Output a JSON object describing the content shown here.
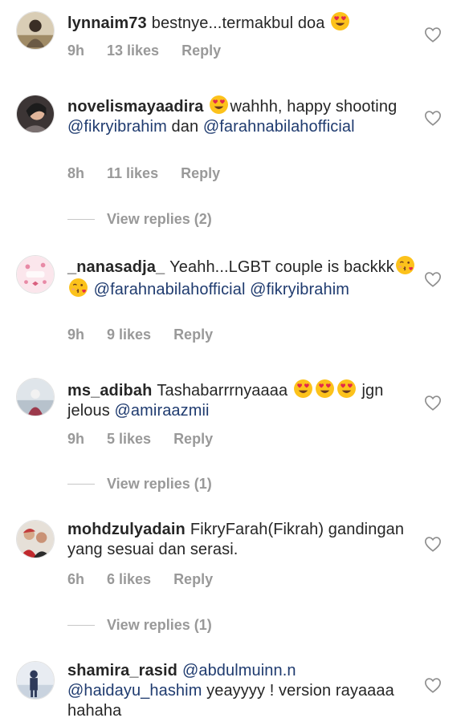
{
  "comments": [
    {
      "username": "lynnaim73",
      "parts": [
        {
          "t": "text",
          "v": "bestnye...termakbul doa "
        },
        {
          "t": "emoji",
          "v": "heart-eyes"
        }
      ],
      "time": "9h",
      "likes": "13 likes",
      "reply": "Reply"
    },
    {
      "username": "novelismayaadira",
      "parts": [
        {
          "t": "emoji",
          "v": "heart-eyes"
        },
        {
          "t": "text",
          "v": "wahhh, happy shooting "
        },
        {
          "t": "mention",
          "v": "@fikryibrahim"
        },
        {
          "t": "text",
          "v": "  dan "
        },
        {
          "t": "mention",
          "v": "@farahnabilahofficial"
        }
      ],
      "time": "8h",
      "likes": "11 likes",
      "reply": "Reply",
      "view_replies": "View replies (2)"
    },
    {
      "username": "_nanasadja_",
      "parts": [
        {
          "t": "text",
          "v": "Yeahh...LGBT couple is backkk"
        },
        {
          "t": "emoji",
          "v": "kiss"
        },
        {
          "t": "emoji",
          "v": "kiss"
        },
        {
          "t": "text",
          "v": " "
        },
        {
          "t": "mention",
          "v": "@farahnabilahofficial"
        },
        {
          "t": "text",
          "v": " "
        },
        {
          "t": "mention",
          "v": "@fikryibrahim"
        }
      ],
      "time": "9h",
      "likes": "9 likes",
      "reply": "Reply"
    },
    {
      "username": "ms_adibah",
      "parts": [
        {
          "t": "text",
          "v": "Tashabarrrnyaaaa "
        },
        {
          "t": "emoji",
          "v": "heart-eyes"
        },
        {
          "t": "emoji",
          "v": "heart-eyes"
        },
        {
          "t": "emoji",
          "v": "heart-eyes"
        },
        {
          "t": "text",
          "v": " jgn jelous "
        },
        {
          "t": "mention",
          "v": "@amiraazmii"
        }
      ],
      "time": "9h",
      "likes": "5 likes",
      "reply": "Reply",
      "view_replies": "View replies (1)"
    },
    {
      "username": "mohdzulyadain",
      "parts": [
        {
          "t": "text",
          "v": "FikryFarah(Fikrah) gandingan yang sesuai dan serasi."
        }
      ],
      "time": "6h",
      "likes": "6 likes",
      "reply": "Reply",
      "view_replies": "View replies (1)"
    },
    {
      "username": "shamira_rasid",
      "parts": [
        {
          "t": "mention",
          "v": "@abdulmuinn.n"
        },
        {
          "t": "text",
          "v": " "
        },
        {
          "t": "mention",
          "v": "@haidayu_hashim"
        },
        {
          "t": "text",
          "v": " yeayyyy ! version rayaaaa hahaha"
        }
      ]
    }
  ],
  "icons": {
    "like": "heart-outline-icon",
    "emoji_heart_eyes": "heart-eyes-emoji-icon",
    "emoji_kiss": "kissing-face-emoji-icon"
  },
  "colors": {
    "mention": "#1f3b6f",
    "meta": "#999999",
    "text": "#262626"
  }
}
